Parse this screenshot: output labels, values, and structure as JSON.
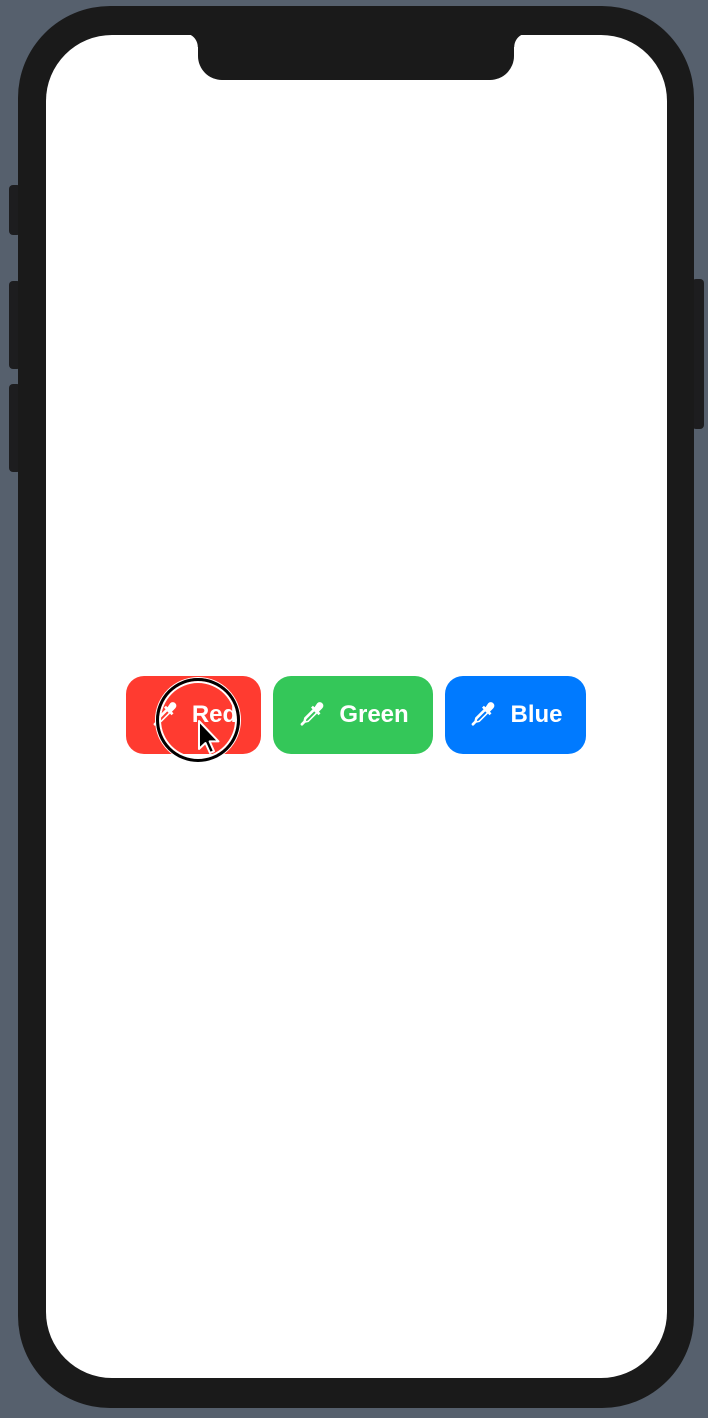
{
  "colors": {
    "device_frame": "#1a1a1a",
    "background": "#56606d",
    "screen": "#ffffff"
  },
  "buttons": [
    {
      "label": "Red",
      "icon": "eyedropper-icon",
      "color": "#ff3b30"
    },
    {
      "label": "Green",
      "icon": "eyedropper-icon",
      "color": "#34c759"
    },
    {
      "label": "Blue",
      "icon": "eyedropper-icon",
      "color": "#007aff"
    }
  ],
  "pointer": {
    "icon": "arrow-cursor-icon",
    "target": "Red"
  }
}
